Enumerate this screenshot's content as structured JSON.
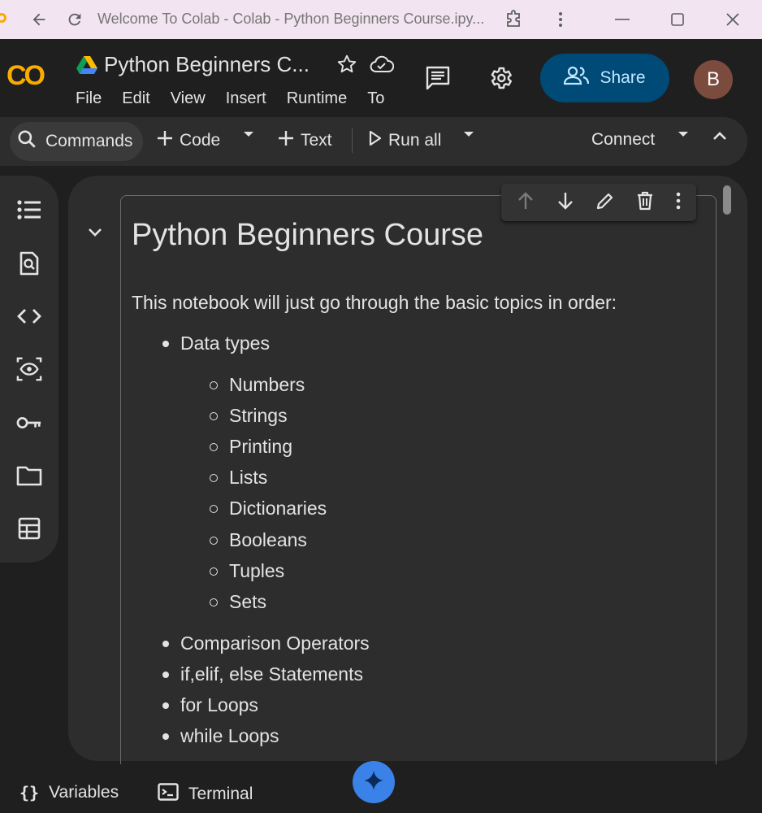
{
  "browser": {
    "tab_title": "Welcome To Colab - Colab - Python Beginners Course.ipy..."
  },
  "app": {
    "logo": "CO",
    "notebook_title": "Python Beginners C...",
    "menu": [
      "File",
      "Edit",
      "View",
      "Insert",
      "Runtime",
      "To"
    ],
    "share_label": "Share",
    "avatar_initial": "B"
  },
  "toolbar": {
    "commands_label": "Commands",
    "code_label": "Code",
    "text_label": "Text",
    "run_all_label": "Run all",
    "connect_label": "Connect"
  },
  "cell": {
    "heading": "Python Beginners Course",
    "intro": "This notebook will just go through the basic topics in order:",
    "topics": [
      {
        "label": "Data types",
        "subtopics": [
          "Numbers",
          "Strings",
          "Printing",
          "Lists",
          "Dictionaries",
          "Booleans",
          "Tuples",
          "Sets"
        ]
      },
      {
        "label": "Comparison Operators"
      },
      {
        "label": "if,elif, else Statements"
      },
      {
        "label": "for Loops"
      },
      {
        "label": "while Loops"
      }
    ]
  },
  "bottom": {
    "variables_label": "Variables",
    "terminal_label": "Terminal"
  },
  "colors": {
    "accent_orange": "#f9ab00",
    "share_bg": "#004a77",
    "gemini_blue": "#3b82e8"
  }
}
